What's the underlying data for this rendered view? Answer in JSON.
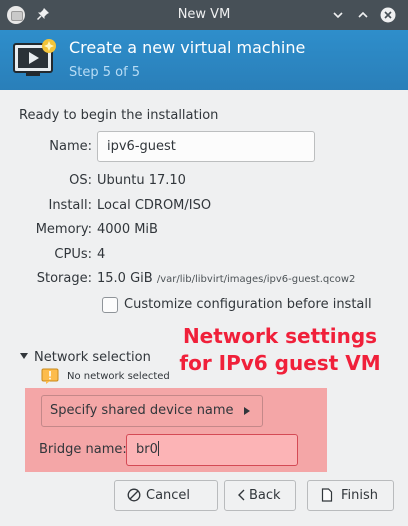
{
  "window": {
    "title": "New VM",
    "icons": [
      "virt-manager-app-icon",
      "pin-icon",
      "minimize-icon",
      "maximize-icon",
      "close-icon"
    ]
  },
  "header": {
    "title": "Create a new virtual machine",
    "step": "Step 5 of 5",
    "icon": "vm-monitor-icon"
  },
  "summary": {
    "heading": "Ready to begin the installation",
    "name_label": "Name:",
    "name_value": "ipv6-guest",
    "os_label": "OS:",
    "os_value": "Ubuntu 17.10",
    "install_label": "Install:",
    "install_value": "Local CDROM/ISO",
    "memory_label": "Memory:",
    "memory_value": "4000 MiB",
    "cpus_label": "CPUs:",
    "cpus_value": "4",
    "storage_label": "Storage:",
    "storage_size": "15.0 GiB",
    "storage_path": "/var/lib/libvirt/images/ipv6-guest.qcow2",
    "customize_label": "Customize configuration before install",
    "customize_checked": false
  },
  "annotation": {
    "text_line1": "Network settings",
    "text_line2": "for IPv6 guest VM",
    "color": "#f0203a"
  },
  "network": {
    "expander_label": "Network selection",
    "warning_text": "No network selected",
    "source_button": "Specify shared device name",
    "bridge_label": "Bridge name:",
    "bridge_value": "br0",
    "highlight_color": "#f4a6a7"
  },
  "buttons": {
    "cancel": "Cancel",
    "back": "Back",
    "finish": "Finish"
  },
  "colors": {
    "titlebar": "#475057",
    "header": "#2a7fb9",
    "background": "#eff0f1"
  }
}
